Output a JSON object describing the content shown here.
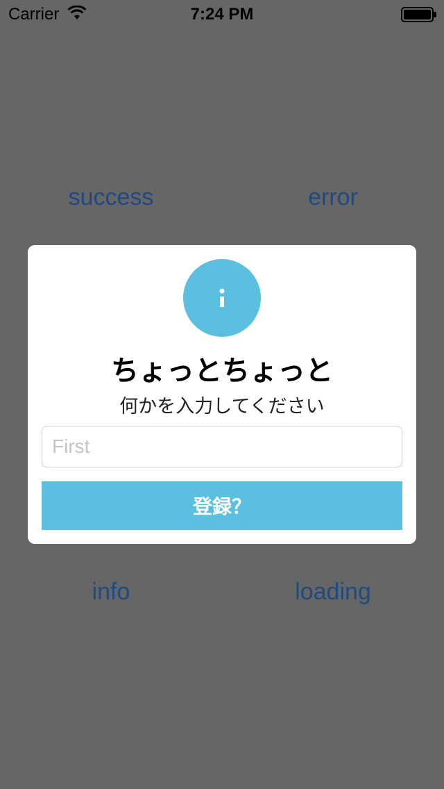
{
  "status_bar": {
    "carrier": "Carrier",
    "time": "7:24 PM",
    "wifi_icon": "wifi-icon",
    "battery_icon": "battery-icon"
  },
  "background_buttons": {
    "success": "success",
    "error": "error",
    "info": "info",
    "loading": "loading"
  },
  "alert": {
    "icon": "info-icon",
    "title": "ちょっとちょっと",
    "subtitle": "何かを入力してください",
    "input_placeholder": "First",
    "input_value": "",
    "button_label": "登録？"
  },
  "colors": {
    "overlay_background": "#666666",
    "accent": "#5bbfe0",
    "link": "#1e4a82"
  }
}
